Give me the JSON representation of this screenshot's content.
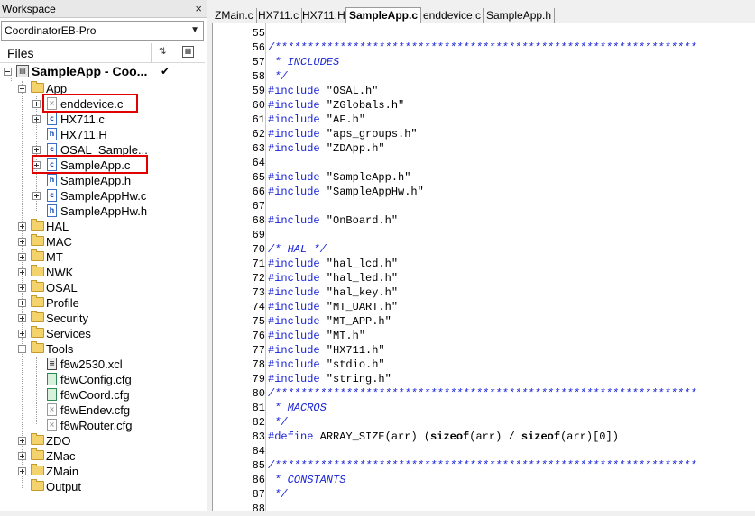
{
  "workspace": {
    "title": "Workspace",
    "close_icon": "×",
    "configuration": "CoordinatorEB-Pro",
    "files_label": "Files",
    "project": "SampleApp - Coo...",
    "tree": [
      {
        "label": "App",
        "type": "folder",
        "expanded": true
      },
      {
        "label": "enddevice.c",
        "type": "file-excluded"
      },
      {
        "label": "HX711.c",
        "type": "c"
      },
      {
        "label": "HX711.H",
        "type": "h"
      },
      {
        "label": "OSAL_Sample...",
        "type": "c"
      },
      {
        "label": "SampleApp.c",
        "type": "c"
      },
      {
        "label": "SampleApp.h",
        "type": "h"
      },
      {
        "label": "SampleAppHw.c",
        "type": "c"
      },
      {
        "label": "SampleAppHw.h",
        "type": "h"
      },
      {
        "label": "HAL",
        "type": "folder"
      },
      {
        "label": "MAC",
        "type": "folder"
      },
      {
        "label": "MT",
        "type": "folder"
      },
      {
        "label": "NWK",
        "type": "folder"
      },
      {
        "label": "OSAL",
        "type": "folder"
      },
      {
        "label": "Profile",
        "type": "folder"
      },
      {
        "label": "Security",
        "type": "folder"
      },
      {
        "label": "Services",
        "type": "folder"
      },
      {
        "label": "Tools",
        "type": "folder",
        "expanded": true
      },
      {
        "label": "f8w2530.xcl",
        "type": "xcl"
      },
      {
        "label": "f8wConfig.cfg",
        "type": "cfg"
      },
      {
        "label": "f8wCoord.cfg",
        "type": "cfg"
      },
      {
        "label": "f8wEndev.cfg",
        "type": "cfg-excluded"
      },
      {
        "label": "f8wRouter.cfg",
        "type": "cfg-excluded"
      },
      {
        "label": "ZDO",
        "type": "folder"
      },
      {
        "label": "ZMac",
        "type": "folder"
      },
      {
        "label": "ZMain",
        "type": "folder"
      },
      {
        "label": "Output",
        "type": "folder"
      }
    ]
  },
  "editor": {
    "tabs": [
      {
        "label": "ZMain.c",
        "active": false
      },
      {
        "label": "HX711.c",
        "active": false
      },
      {
        "label": "HX711.H",
        "active": false
      },
      {
        "label": "SampleApp.c",
        "active": true
      },
      {
        "label": "enddevice.c",
        "active": false
      },
      {
        "label": "SampleApp.h",
        "active": false
      }
    ],
    "lines": [
      {
        "n": "55",
        "text": ""
      },
      {
        "n": "56",
        "text": "/*****************************************************************",
        "style": "cm"
      },
      {
        "n": "57",
        "text": " * INCLUDES",
        "style": "cm"
      },
      {
        "n": "58",
        "text": " */",
        "style": "cm"
      },
      {
        "n": "59",
        "kw": "#include",
        "text": " \"OSAL.h\""
      },
      {
        "n": "60",
        "kw": "#include",
        "text": " \"ZGlobals.h\""
      },
      {
        "n": "61",
        "kw": "#include",
        "text": " \"AF.h\""
      },
      {
        "n": "62",
        "kw": "#include",
        "text": " \"aps_groups.h\""
      },
      {
        "n": "63",
        "kw": "#include",
        "text": " \"ZDApp.h\""
      },
      {
        "n": "64",
        "text": ""
      },
      {
        "n": "65",
        "kw": "#include",
        "text": " \"SampleApp.h\""
      },
      {
        "n": "66",
        "kw": "#include",
        "text": " \"SampleAppHw.h\""
      },
      {
        "n": "67",
        "text": ""
      },
      {
        "n": "68",
        "kw": "#include",
        "text": " \"OnBoard.h\""
      },
      {
        "n": "69",
        "text": ""
      },
      {
        "n": "70",
        "text": "/* HAL */",
        "style": "cm"
      },
      {
        "n": "71",
        "kw": "#include",
        "text": " \"hal_lcd.h\""
      },
      {
        "n": "72",
        "kw": "#include",
        "text": " \"hal_led.h\""
      },
      {
        "n": "73",
        "kw": "#include",
        "text": " \"hal_key.h\""
      },
      {
        "n": "74",
        "kw": "#include",
        "text": " \"MT_UART.h\""
      },
      {
        "n": "75",
        "kw": "#include",
        "text": " \"MT_APP.h\""
      },
      {
        "n": "76",
        "kw": "#include",
        "text": " \"MT.h\""
      },
      {
        "n": "77",
        "kw": "#include",
        "text": " \"HX711.h\""
      },
      {
        "n": "78",
        "kw": "#include",
        "text": " \"stdio.h\""
      },
      {
        "n": "79",
        "kw": "#include",
        "text": " \"string.h\""
      },
      {
        "n": "80",
        "text": "/*****************************************************************",
        "style": "cm"
      },
      {
        "n": "81",
        "text": " * MACROS",
        "style": "cm"
      },
      {
        "n": "82",
        "text": " */",
        "style": "cm"
      },
      {
        "n": "83",
        "kw": "#define",
        "text": " ARRAY_SIZE(arr) (sizeof(arr) / sizeof(arr)[0])"
      },
      {
        "n": "84",
        "text": ""
      },
      {
        "n": "85",
        "text": "/*****************************************************************",
        "style": "cm"
      },
      {
        "n": "86",
        "text": " * CONSTANTS",
        "style": "cm"
      },
      {
        "n": "87",
        "text": " */",
        "style": "cm"
      },
      {
        "n": "88",
        "text": ""
      }
    ]
  }
}
